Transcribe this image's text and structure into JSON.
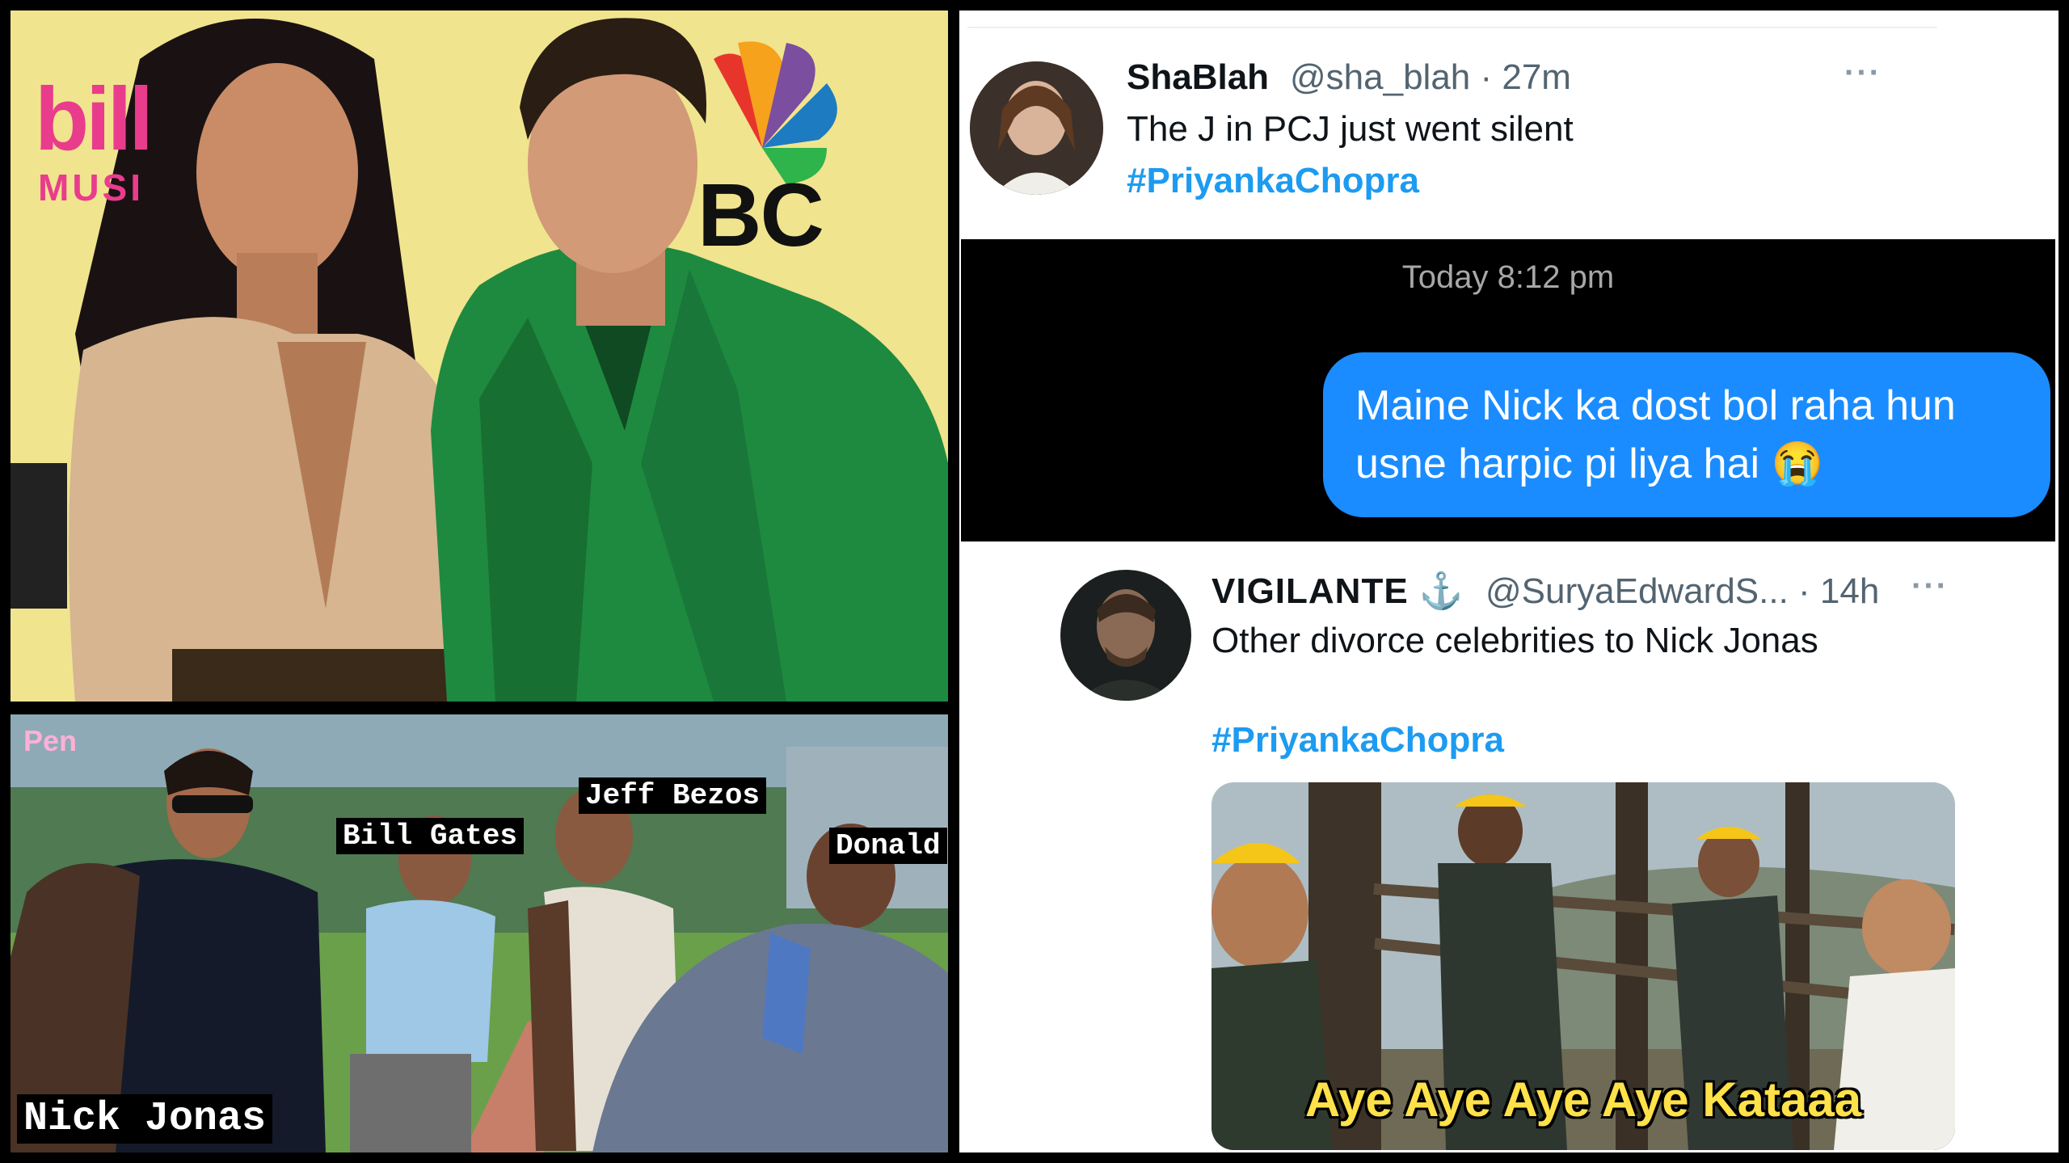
{
  "photo_panel": {
    "backdrop_logo": "bill",
    "backdrop_sub": "MUSI",
    "network_logo": "BC"
  },
  "meme_left": {
    "watermark": "Pen",
    "labels": {
      "person1": "Nick Jonas",
      "person2": "Bill Gates",
      "person3": "Jeff Bezos",
      "person4": "Donald"
    }
  },
  "tweet1": {
    "name": "ShaBlah",
    "handle": "@sha_blah · 27m",
    "text": "The J in PCJ just went silent",
    "hashtag": "#PriyankaChopra",
    "more": "···"
  },
  "chat": {
    "timestamp": "Today 8:12 pm",
    "message_line1": "Maine Nick ka dost bol raha hun",
    "message_line2": "usne harpic pi liya hai",
    "emoji": "😭"
  },
  "tweet2": {
    "name": "VIGILANTE ⚓",
    "handle": "@SuryaEdwardS... · 14h",
    "text": "Other divorce celebrities to Nick Jonas",
    "hashtag": "#PriyankaChopra",
    "more": "···"
  },
  "meme_right": {
    "caption": "Aye Aye Aye Aye Kataaa"
  },
  "colors": {
    "hashtag_blue": "#1d9bf0",
    "bubble_blue": "#1a8cff",
    "billboard_pink": "#ea3c8c"
  }
}
